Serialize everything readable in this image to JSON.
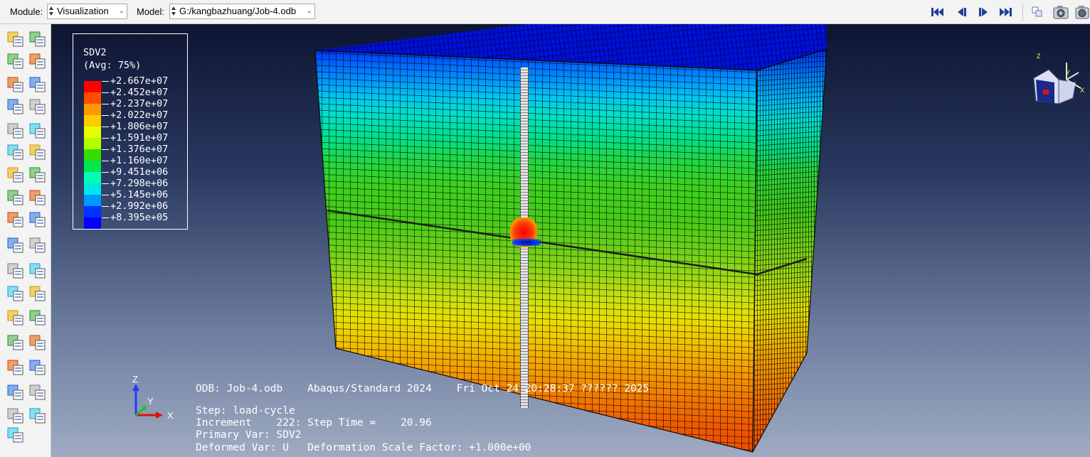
{
  "toolbar": {
    "module_label": "Module:",
    "module_value": "Visualization",
    "model_label": "Model:",
    "model_value": "G:/kangbazhuang/Job-4.odb",
    "nav_icons": [
      "first-frame-icon",
      "previous-frame-icon",
      "next-frame-icon",
      "last-frame-icon"
    ],
    "right_icons": [
      "layout-icon",
      "camera-icon",
      "camera-settings-icon"
    ]
  },
  "legend": {
    "title": "SDV2",
    "subtitle": "(Avg: 75%)",
    "values": [
      "+2.667e+07",
      "+2.452e+07",
      "+2.237e+07",
      "+2.022e+07",
      "+1.806e+07",
      "+1.591e+07",
      "+1.376e+07",
      "+1.160e+07",
      "+9.451e+06",
      "+7.298e+06",
      "+5.145e+06",
      "+2.992e+06",
      "+8.395e+05"
    ],
    "colors": [
      "#ff0000",
      "#ff4d00",
      "#ff9900",
      "#ffcc00",
      "#e6ff00",
      "#b3ff00",
      "#33dd00",
      "#00e64d",
      "#00ffb3",
      "#00e6e6",
      "#0099ff",
      "#0033ff",
      "#0000ff"
    ]
  },
  "info": {
    "odb_line": "ODB: Job-4.odb    Abaqus/Standard 2024    Fri Oct 24 20:28:37 ?????? 2025",
    "step_line": "Step: load-cycle",
    "increment_line": "Increment    222: Step Time =    20.96",
    "primary_line": "Primary Var: SDV2",
    "deformed_line": "Deformed Var: U   Deformation Scale Factor: +1.000e+00"
  },
  "axes": {
    "x": "X",
    "y": "Y",
    "z": "Z"
  },
  "tools": [
    "query-icon",
    "probe-icon",
    "deformed-shape-icon",
    "undeformed-shape-icon",
    "contour-plot-icon",
    "contour-options-icon",
    "symbol-plot-icon",
    "symbol-options-icon",
    "material-orientation-icon",
    "orientation-options-icon",
    "superimpose-icon",
    "allow-multiple-icon",
    "animate-time-icon",
    "animate-scale-icon",
    "animate-harmonic-icon",
    "animation-options-icon",
    "view-cut-icon",
    "view-cut-manager-icon",
    "xy-data-icon",
    "xy-data-manager-icon",
    "path-icon",
    "xy-plot-icon",
    "display-group-icon",
    "display-group-manager-icon",
    "free-body-icon",
    "free-body-manager-icon",
    "stream-icon",
    "stream-manager-icon",
    "section-points-icon",
    "section-manager-icon",
    "overlay-icon",
    "overlay-manager-icon",
    "report-icon",
    "report-manager-icon",
    "tool-extra-icon"
  ]
}
